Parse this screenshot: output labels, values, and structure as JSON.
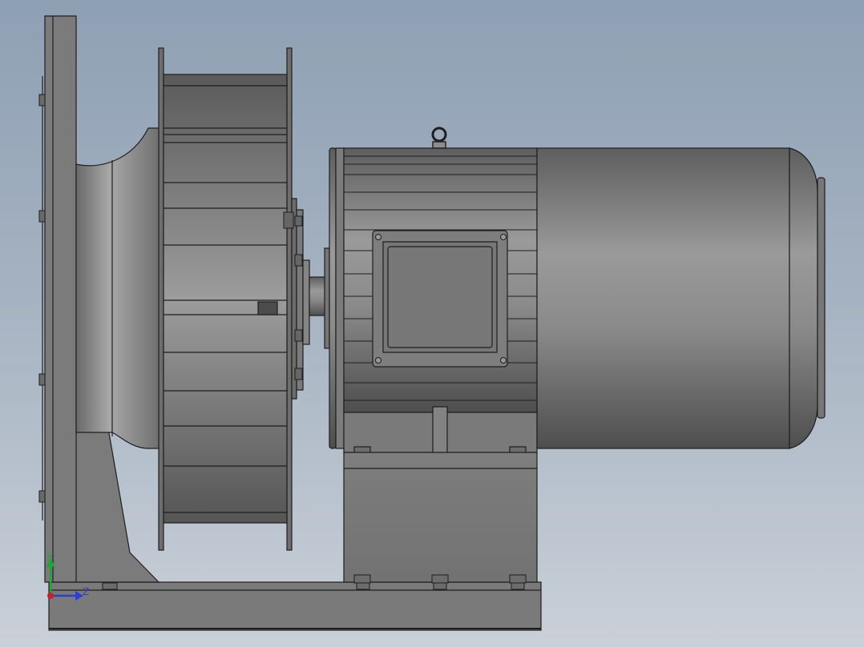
{
  "viewport": {
    "background_top": "#8ea0b4",
    "background_bottom": "#c9d0d8",
    "model_color": "#7c7c7c",
    "edge_color": "#1e1e1e"
  },
  "triad": {
    "y_label": "Y",
    "z_label": "Z",
    "y_color": "#22a43a",
    "z_color": "#2a3fd6",
    "origin_color": "#c8202a"
  }
}
